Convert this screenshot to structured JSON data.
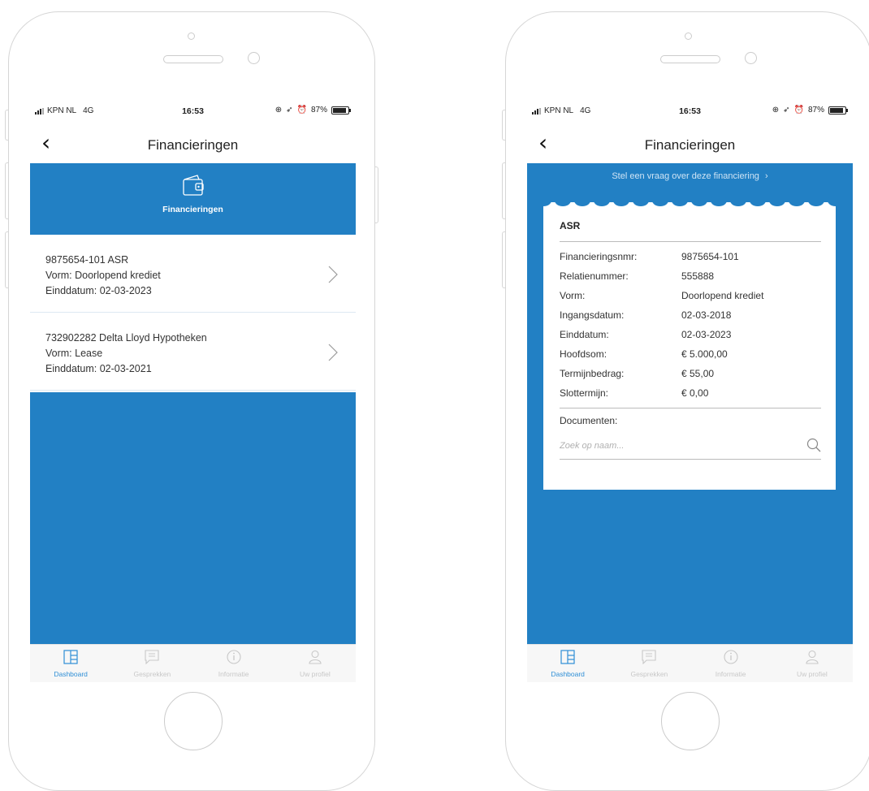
{
  "status": {
    "carrier": "KPN NL",
    "network": "4G",
    "time": "16:53",
    "battery": "87%"
  },
  "left": {
    "title": "Financieringen",
    "hero_label": "Financieringen",
    "items": [
      {
        "line1": "9875654-101  ASR",
        "line2": "Vorm: Doorlopend krediet",
        "line3": "Einddatum: 02-03-2023"
      },
      {
        "line1": "732902282  Delta Lloyd Hypotheken",
        "line2": "Vorm: Lease",
        "line3": "Einddatum: 02-03-2021"
      }
    ]
  },
  "right": {
    "title": "Financieringen",
    "question_link": "Stel een vraag over deze financiering",
    "card_title": "ASR",
    "details": [
      {
        "key": "Financieringsnmr:",
        "value": "9875654-101"
      },
      {
        "key": "Relatienummer:",
        "value": "555888"
      },
      {
        "key": "Vorm:",
        "value": "Doorlopend krediet"
      },
      {
        "key": "Ingangsdatum:",
        "value": "02-03-2018"
      },
      {
        "key": "Einddatum:",
        "value": "02-03-2023"
      },
      {
        "key": "Hoofdsom:",
        "value": "€ 5.000,00"
      },
      {
        "key": "Termijnbedrag:",
        "value": "€ 55,00"
      },
      {
        "key": "Slottermijn:",
        "value": "€ 0,00"
      }
    ],
    "documents_label": "Documenten:",
    "search_placeholder": "Zoek op naam..."
  },
  "tabs": [
    {
      "label": "Dashboard",
      "icon": "dashboard-icon",
      "active": true
    },
    {
      "label": "Gesprekken",
      "icon": "chat-icon",
      "active": false
    },
    {
      "label": "Informatie",
      "icon": "info-icon",
      "active": false
    },
    {
      "label": "Uw profiel",
      "icon": "profile-icon",
      "active": false
    }
  ],
  "colors": {
    "primary_blue": "#2280c4",
    "active_tab": "#2f8fd6",
    "inactive_tab": "#c8c8c8"
  }
}
